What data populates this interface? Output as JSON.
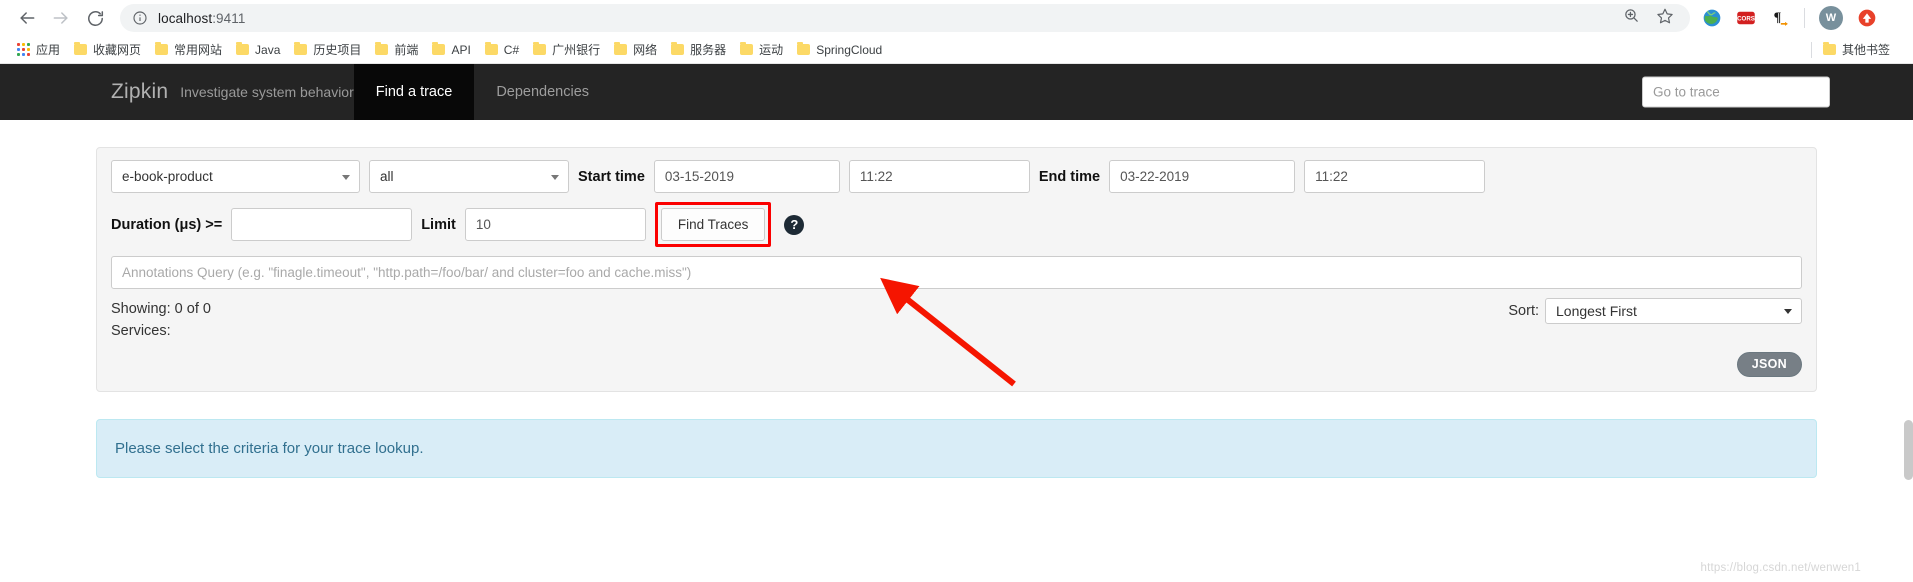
{
  "browser": {
    "nav": {
      "back": "back-arrow",
      "forward": "forward-arrow",
      "reload": "reload"
    },
    "url": {
      "host": "localhost",
      "port": ":9411",
      "site_info_icon": "info-circle-icon"
    },
    "omnibox_actions": [
      "zoom-icon",
      "bookmark-star-icon"
    ],
    "extensions": [
      "globe-extension-icon",
      "cors-extension-icon",
      "pilcrow-extension-icon"
    ],
    "profile": {
      "initial": "W"
    },
    "upload_icon": "upload-arrow-icon"
  },
  "bookmarks": {
    "apps_label": "应用",
    "items": [
      {
        "label": "收藏网页"
      },
      {
        "label": "常用网站"
      },
      {
        "label": "Java"
      },
      {
        "label": "历史项目"
      },
      {
        "label": "前端"
      },
      {
        "label": "API"
      },
      {
        "label": "C#"
      },
      {
        "label": "广州银行"
      },
      {
        "label": "网络"
      },
      {
        "label": "服务器"
      },
      {
        "label": "运动"
      },
      {
        "label": "SpringCloud"
      }
    ],
    "other": {
      "label": "其他书签"
    }
  },
  "zipkin": {
    "brand": "Zipkin",
    "tagline": "Investigate system behavior",
    "tabs": [
      {
        "label": "Find a trace",
        "active": true
      },
      {
        "label": "Dependencies",
        "active": false
      }
    ],
    "go_to_trace_placeholder": "Go to trace"
  },
  "search_form": {
    "service": {
      "value": "e-book-product"
    },
    "span": {
      "value": "all"
    },
    "start_time_label": "Start time",
    "start_date": "03-15-2019",
    "start_clock": "11:22",
    "end_time_label": "End time",
    "end_date": "03-22-2019",
    "end_clock": "11:22",
    "duration_label": "Duration (μs) >=",
    "duration_value": "",
    "limit_label": "Limit",
    "limit_value": "10",
    "find_traces_label": "Find Traces",
    "help_icon": "?",
    "annotations_placeholder": "Annotations Query (e.g. \"finagle.timeout\", \"http.path=/foo/bar/ and cluster=foo and cache.miss\")"
  },
  "results": {
    "showing": "Showing: 0 of 0",
    "services": "Services:",
    "sort_label": "Sort:",
    "sort_value": "Longest First",
    "json_label": "JSON"
  },
  "alert": {
    "message": "Please select the criteria for your trace lookup."
  },
  "annotation": {
    "highlight_color": "#fb0000",
    "arrow_color": "#f51500"
  },
  "watermark": {
    "text": "https://blog.csdn.net/wenwen1"
  }
}
